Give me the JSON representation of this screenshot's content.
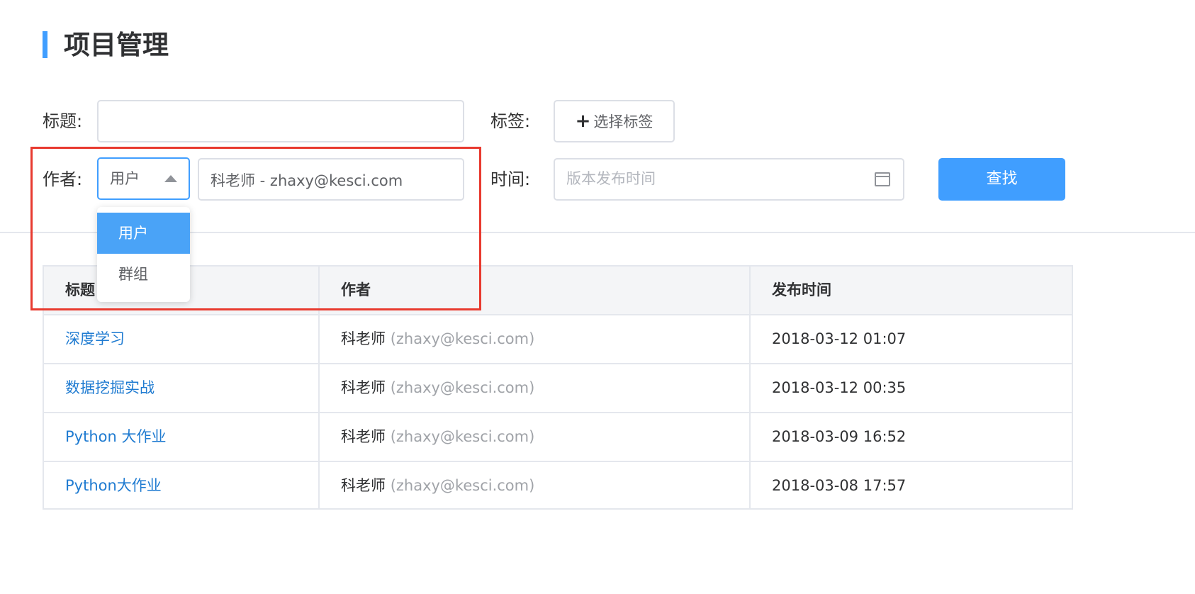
{
  "page": {
    "title": "项目管理"
  },
  "form": {
    "title_label": "标题:",
    "title_value": "",
    "tags_label": "标签:",
    "tags_button": "选择标签",
    "author_label": "作者:",
    "author_type_selected": "用户",
    "author_type_options": [
      "用户",
      "群组"
    ],
    "author_value": "科老师 - zhaxy@kesci.com",
    "time_label": "时间:",
    "time_placeholder": "版本发布时间",
    "search_button": "查找"
  },
  "table": {
    "headers": [
      "标题",
      "作者",
      "发布时间"
    ],
    "rows": [
      {
        "title": "深度学习",
        "author_name": "科老师",
        "author_email": "(zhaxy@kesci.com)",
        "time": "2018-03-12 01:07"
      },
      {
        "title": "数据挖掘实战",
        "author_name": "科老师",
        "author_email": "(zhaxy@kesci.com)",
        "time": "2018-03-12 00:35"
      },
      {
        "title": "Python 大作业",
        "author_name": "科老师",
        "author_email": "(zhaxy@kesci.com)",
        "time": "2018-03-09 16:52"
      },
      {
        "title": "Python大作业",
        "author_name": "科老师",
        "author_email": "(zhaxy@kesci.com)",
        "time": "2018-03-08 17:57"
      }
    ]
  },
  "colors": {
    "accent": "#409eff",
    "link": "#1f7bd1",
    "highlight": "#e83a2f"
  },
  "icons": {
    "tags_button": "plus-icon",
    "author_select": "caret-up-icon",
    "time_input": "calendar-icon"
  }
}
